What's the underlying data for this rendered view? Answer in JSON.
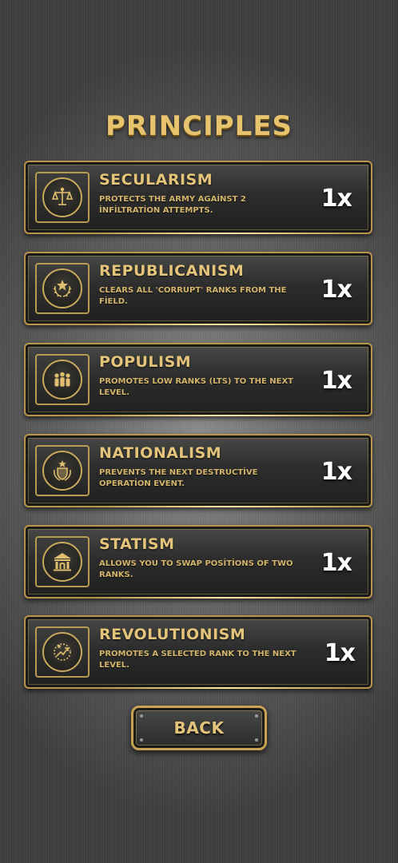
{
  "screen": {
    "title": "PRINCIPLES"
  },
  "principles": [
    {
      "name": "SECULARISM",
      "description": "PROTECTS THE ARMY AGAİNST 2 İNFİLTRATİON ATTEMPTS.",
      "count": "1x",
      "icon": "scales-icon"
    },
    {
      "name": "REPUBLICANISM",
      "description": "CLEARS ALL 'CORRUPT' RANKS FROM THE FİELD.",
      "count": "1x",
      "icon": "star-laurel-icon"
    },
    {
      "name": "POPULISM",
      "description": "PROMOTES LOW RANKS (LTS) TO THE NEXT LEVEL.",
      "count": "1x",
      "icon": "people-icon"
    },
    {
      "name": "NATIONALISM",
      "description": "PREVENTS THE NEXT DESTRUCTİVE OPERATİON EVENT.",
      "count": "1x",
      "icon": "shield-star-icon"
    },
    {
      "name": "STATISM",
      "description": "ALLOWS YOU TO SWAP POSİTİONS OF TWO RANKS.",
      "count": "1x",
      "icon": "building-icon"
    },
    {
      "name": "REVOLUTIONISM",
      "description": "PROMOTES A SELECTED RANK TO THE NEXT LEVEL.",
      "count": "1x",
      "icon": "rising-arrow-icon"
    }
  ],
  "back_button": {
    "label": "BACK"
  }
}
